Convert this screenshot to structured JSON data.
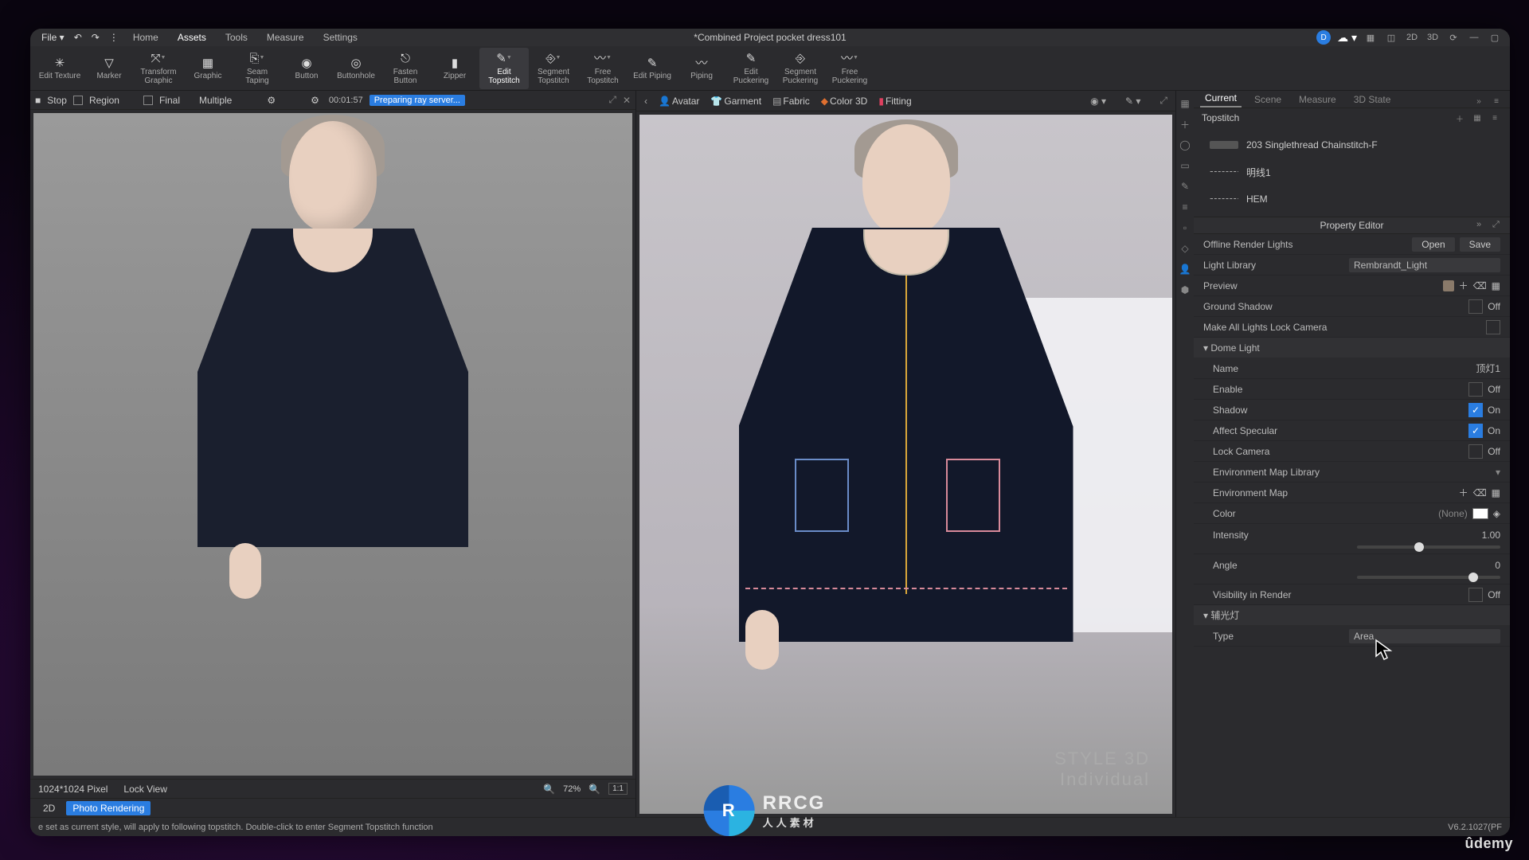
{
  "menubar": {
    "file": "File ▾",
    "items": [
      "Home",
      "Assets",
      "Tools",
      "Measure",
      "Settings"
    ],
    "active_idx": 1,
    "title": "*Combined Project pocket dress101",
    "view2d": "2D",
    "view3d": "3D"
  },
  "ribbon": [
    {
      "label": "Edit Texture"
    },
    {
      "label": "Marker"
    },
    {
      "label": "Transform\nGraphic"
    },
    {
      "label": "Graphic"
    },
    {
      "label": "Seam\nTaping"
    },
    {
      "label": "Button"
    },
    {
      "label": "Buttonhole"
    },
    {
      "label": "Fasten\nButton"
    },
    {
      "label": "Zipper"
    },
    {
      "label": "Edit\nTopstitch",
      "active": true
    },
    {
      "label": "Segment\nTopstitch"
    },
    {
      "label": "Free Topstitch"
    },
    {
      "label": "Edit Piping"
    },
    {
      "label": "Piping"
    },
    {
      "label": "Edit\nPuckering"
    },
    {
      "label": "Segment\nPuckering"
    },
    {
      "label": "Free Puckering"
    }
  ],
  "left_toolbar": {
    "stop": "Stop",
    "region": "Region",
    "final": "Final",
    "multiple": "Multiple",
    "time": "00:01:57",
    "status": "Preparing ray server..."
  },
  "left_footer": {
    "res": "1024*1024 Pixel",
    "lock": "Lock View",
    "zoom": "72%",
    "ratio": "1:1"
  },
  "left_tabs": {
    "t2d": "2D",
    "photo": "Photo Rendering"
  },
  "mid_top": {
    "avatar": "Avatar",
    "garment": "Garment",
    "fabric": "Fabric",
    "color3d": "Color 3D",
    "fitting": "Fitting"
  },
  "brand": {
    "l1": "STYLE 3D",
    "l2": "Individual"
  },
  "right_tabs": [
    "Current",
    "Scene",
    "Measure",
    "3D State"
  ],
  "right_active": 0,
  "right_section": "Topstitch",
  "right_items": [
    {
      "name": "203 Singlethread Chainstitch-F"
    },
    {
      "name": "明线1"
    },
    {
      "name": "HEM"
    }
  ],
  "prop_title": "Property Editor",
  "prop": {
    "head": "Offline Render Lights",
    "open": "Open",
    "save": "Save",
    "light_library_l": "Light Library",
    "light_library_v": "Rembrandt_Light",
    "preview_l": "Preview",
    "ground_shadow_l": "Ground Shadow",
    "ground_shadow_v": "Off",
    "make_all_l": "Make All Lights Lock Camera",
    "dome_l": "Dome Light",
    "name_l": "Name",
    "name_v": "顶灯1",
    "enable_l": "Enable",
    "enable_v": "Off",
    "shadow_l": "Shadow",
    "shadow_v": "On",
    "spec_l": "Affect Specular",
    "spec_v": "On",
    "lockcam_l": "Lock Camera",
    "lockcam_v": "Off",
    "envlib_l": "Environment Map Library",
    "envmap_l": "Environment Map",
    "color_l": "Color",
    "color_v": "(None)",
    "intensity_l": "Intensity",
    "intensity_v": "1.00",
    "angle_l": "Angle",
    "angle_v": "0",
    "vis_l": "Visibility in Render",
    "vis_v": "Off",
    "fill_l": "辅光灯",
    "type_l": "Type",
    "type_v": "Area"
  },
  "status": {
    "hint": "e set as current style, will apply to following topstitch. Double-click to enter Segment Topstitch function",
    "version": "V6.2.1027(PF"
  },
  "rrcg": {
    "logo": "R",
    "name": "RRCG",
    "sub": "人人素材"
  },
  "udemy": "ûdemy"
}
